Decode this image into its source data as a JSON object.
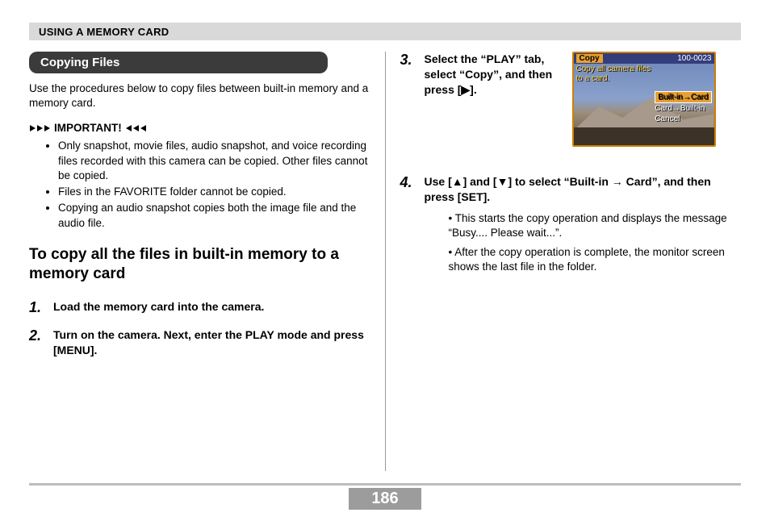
{
  "header": {
    "title": "USING A MEMORY CARD"
  },
  "section": {
    "title": "Copying Files"
  },
  "intro": "Use the procedures below to copy files between built-in memory and a memory card.",
  "important": {
    "label": "IMPORTANT!",
    "items": [
      "Only snapshot, movie files, audio snapshot, and voice recording files recorded with this camera can be copied. Other files cannot be copied.",
      "Files in the FAVORITE folder cannot be copied.",
      "Copying an audio snapshot copies both the image file and the audio file."
    ]
  },
  "subhead": "To copy all the files in built-in memory to a memory card",
  "steps": [
    {
      "n": "1.",
      "text": "Load the memory card into the camera."
    },
    {
      "n": "2.",
      "text": "Turn on the camera. Next, enter the PLAY mode and press [MENU]."
    },
    {
      "n": "3.",
      "text": "Select the “PLAY” tab, select “Copy”, and then press [▶]."
    },
    {
      "n": "4.",
      "text": "Use [▲] and [▼] to select “Built-in → Card”, and then press [SET]."
    }
  ],
  "step4_sub": [
    "This starts the copy operation and displays the message “Busy.... Please wait...”.",
    "After the copy operation is complete, the monitor screen shows the last file in the folder."
  ],
  "cam": {
    "copy": "Copy",
    "id": "100-0023",
    "caption1": "Copy all camera files",
    "caption2": "to a card.",
    "opt1": "Built-in→Card",
    "opt2": "Card→Built-in",
    "opt3": "Cancel"
  },
  "pagenum": "186"
}
